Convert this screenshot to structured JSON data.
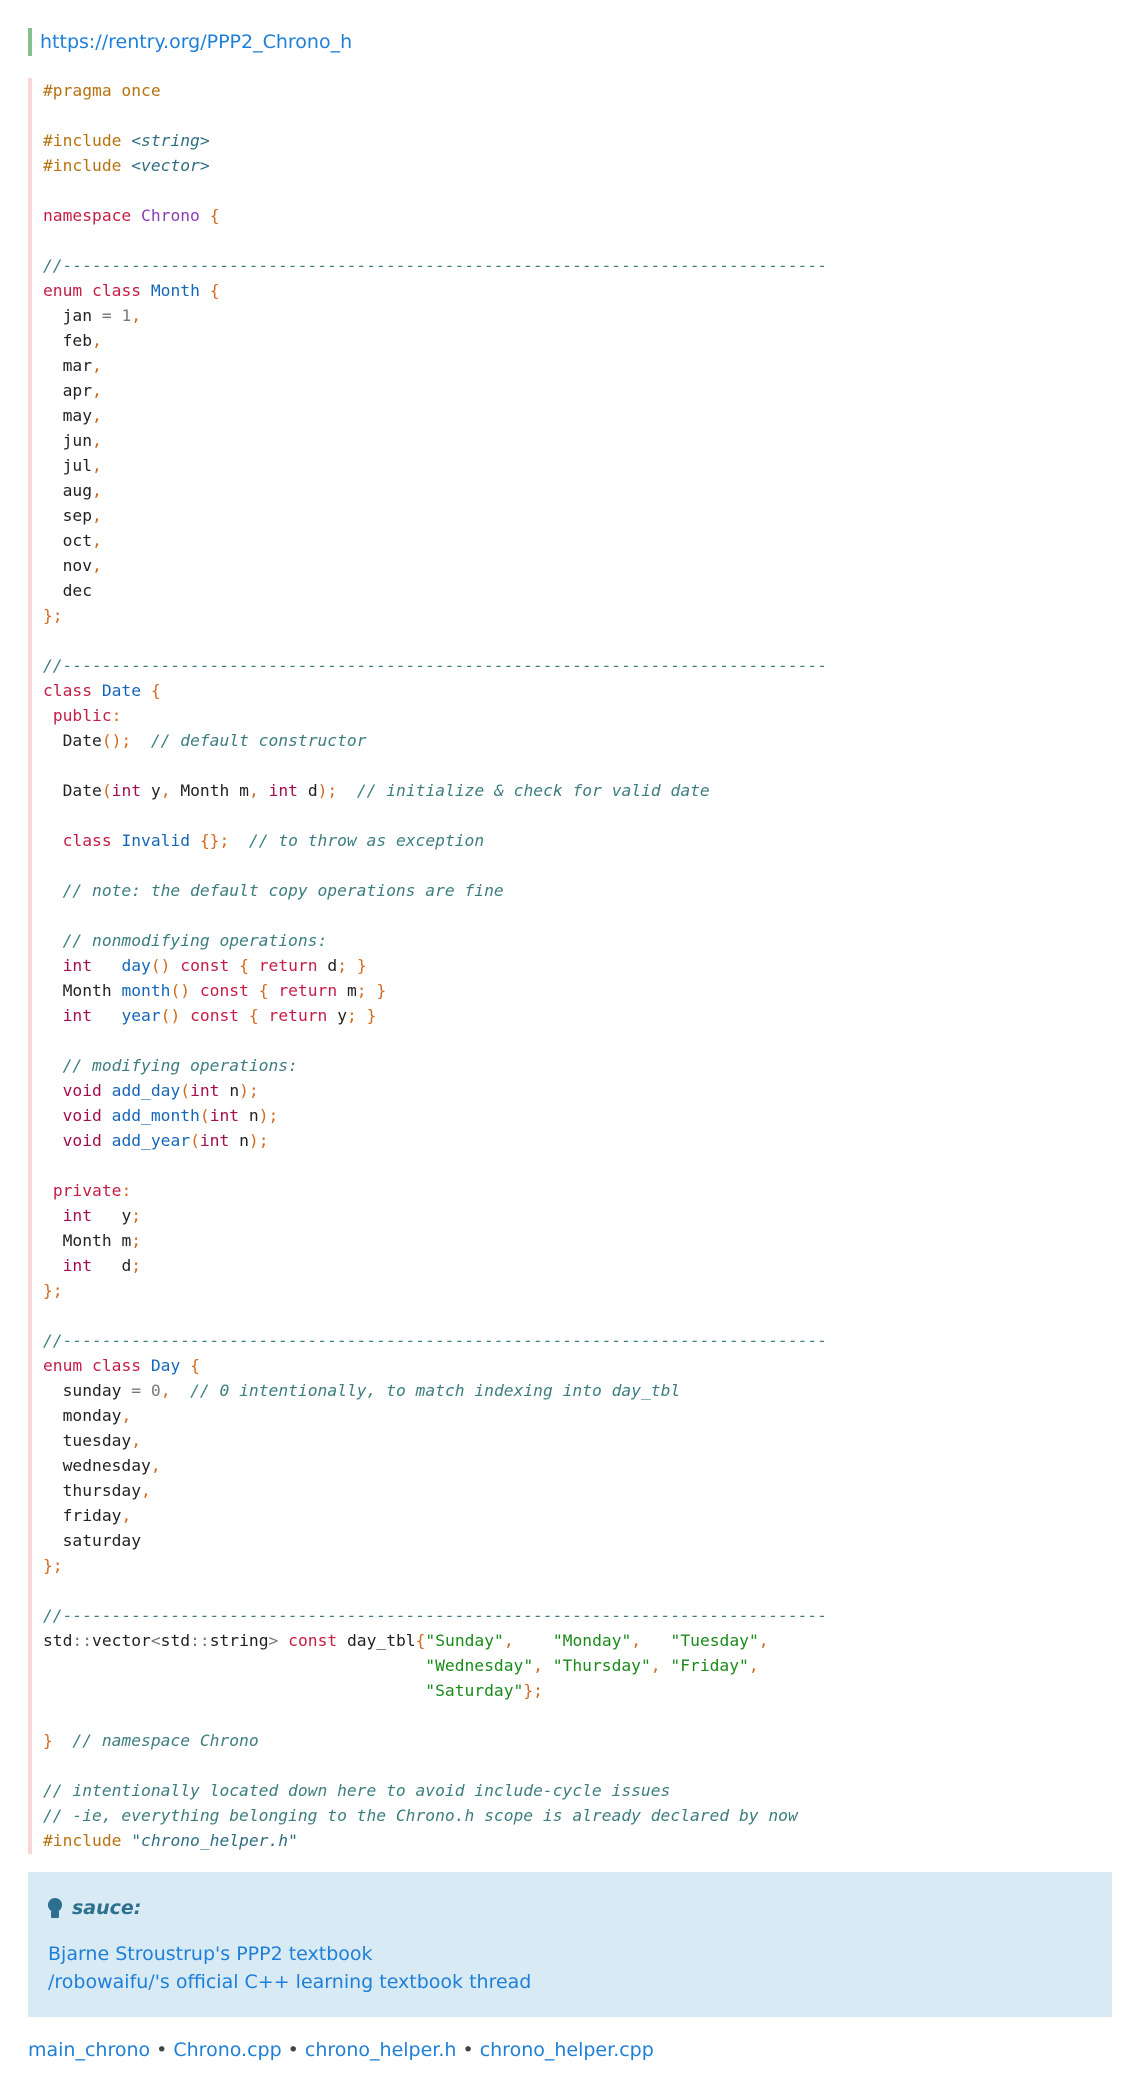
{
  "source_link": "https://rentry.org/PPP2_Chrono_h",
  "code": {
    "pragma": "#pragma once",
    "include_directive": "#include",
    "header_string": "<string>",
    "header_vector": "<vector>",
    "kw_namespace": "namespace",
    "namespace_name": "Chrono",
    "rule": "//------------------------------------------------------------------------------",
    "kw_enum": "enum",
    "kw_class": "class",
    "month_class": "Month",
    "month_values": [
      "jan",
      "feb",
      "mar",
      "apr",
      "may",
      "jun",
      "jul",
      "aug",
      "sep",
      "oct",
      "nov",
      "dec"
    ],
    "one": "1",
    "date_class": "Date",
    "kw_public": "public",
    "ctor_name": "Date",
    "comment_default_ctor": "// default constructor",
    "kw_int": "int",
    "month_type": "Month",
    "comment_init": "// initialize & check for valid date",
    "invalid_class": "Invalid",
    "comment_throw": "// to throw as exception",
    "comment_copy": "// note: the default copy operations are fine",
    "comment_nonmod": "// nonmodifying operations:",
    "fn_day": "day",
    "fn_month": "month",
    "fn_year": "year",
    "kw_const": "const",
    "kw_return": "return",
    "comment_mod": "// modifying operations:",
    "kw_void": "void",
    "fn_add_day": "add_day",
    "fn_add_month": "add_month",
    "fn_add_year": "add_year",
    "kw_private": "private",
    "var_y": "y",
    "var_m": "m",
    "var_d": "d",
    "var_n": "n",
    "day_class": "Day",
    "day_values": [
      "sunday",
      "monday",
      "tuesday",
      "wednesday",
      "thursday",
      "friday",
      "saturday"
    ],
    "zero": "0",
    "comment_zero": "// 0 intentionally, to match indexing into day_tbl",
    "std": "std",
    "vector_t": "vector",
    "string_t": "string",
    "day_tbl": "day_tbl",
    "day_strings": [
      "\"Sunday\"",
      "\"Monday\"",
      "\"Tuesday\"",
      "\"Wednesday\"",
      "\"Thursday\"",
      "\"Friday\"",
      "\"Saturday\""
    ],
    "comment_ns_end": "// namespace Chrono",
    "comment_located": "// intentionally located down here to avoid include-cycle issues",
    "comment_ie": "// -ie, everything belonging to the Chrono.h scope is already declared by now",
    "helper_include": "\"chrono_helper.h\""
  },
  "admonition": {
    "icon": "lightbulb-icon",
    "title": "sauce:",
    "links": [
      "Bjarne Stroustrup's PPP2 textbook",
      "/robowaifu/'s official C++ learning textbook thread"
    ]
  },
  "footer": {
    "links": [
      "main_chrono",
      "Chrono.cpp",
      "chrono_helper.h",
      "chrono_helper.cpp"
    ],
    "separator": "•"
  }
}
